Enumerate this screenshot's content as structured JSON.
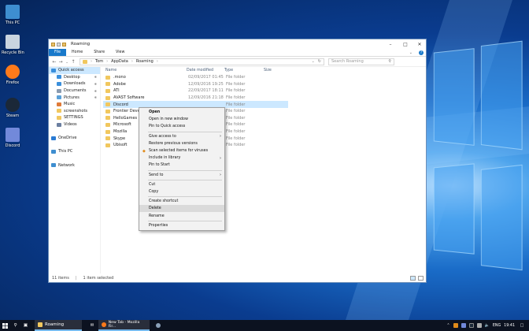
{
  "desktop": {
    "icons": [
      {
        "label": "This PC",
        "icon": "this-pc-icon",
        "color": "#3e8ed0"
      },
      {
        "label": "Recycle Bin",
        "icon": "recycle-bin-icon",
        "color": "#c9d4df"
      },
      {
        "label": "Firefox",
        "icon": "firefox-icon",
        "color": "#ff7a1a"
      },
      {
        "label": "Steam",
        "icon": "steam-icon",
        "color": "#1b2838"
      },
      {
        "label": "Discord",
        "icon": "discord-icon",
        "color": "#7289da"
      }
    ]
  },
  "explorer": {
    "title": "Roaming",
    "ribbon_tabs": [
      "File",
      "Home",
      "Share",
      "View"
    ],
    "breadcrumb": [
      "Tom",
      "AppData",
      "Roaming"
    ],
    "search_placeholder": "Search Roaming",
    "nav": [
      {
        "label": "Quick access",
        "icon": "star-icon",
        "color": "#3a8fdc",
        "pinned": false,
        "selected": true
      },
      {
        "label": "Desktop",
        "icon": "folder-icon",
        "color": "#3a8fdc",
        "pinned": true
      },
      {
        "label": "Downloads",
        "icon": "download-icon",
        "color": "#3a8fdc",
        "pinned": true
      },
      {
        "label": "Documents",
        "icon": "documents-icon",
        "color": "#8a9bb0",
        "pinned": true
      },
      {
        "label": "Pictures",
        "icon": "pictures-icon",
        "color": "#5aa0d8",
        "pinned": true
      },
      {
        "label": "Music",
        "icon": "music-icon",
        "color": "#e07b39"
      },
      {
        "label": "screenshots",
        "icon": "folder-icon",
        "color": "#f1c75e"
      },
      {
        "label": "SETTINGS",
        "icon": "folder-icon",
        "color": "#f1c75e"
      },
      {
        "label": "Videos",
        "icon": "videos-icon",
        "color": "#6b7fa0"
      },
      {
        "label": "",
        "icon": "",
        "color": ""
      },
      {
        "label": "OneDrive",
        "icon": "onedrive-icon",
        "color": "#2a7bd4"
      },
      {
        "label": "",
        "icon": "",
        "color": ""
      },
      {
        "label": "This PC",
        "icon": "this-pc-icon",
        "color": "#3e8ed0"
      },
      {
        "label": "",
        "icon": "",
        "color": ""
      },
      {
        "label": "Network",
        "icon": "network-icon",
        "color": "#3e8ed0"
      }
    ],
    "columns": {
      "name": "Name",
      "date": "Date modified",
      "type": "Type",
      "size": "Size"
    },
    "files": [
      {
        "name": ".mono",
        "date": "02/09/2017 01:45",
        "type": "File folder"
      },
      {
        "name": "Adobe",
        "date": "12/09/2016 19:25",
        "type": "File folder"
      },
      {
        "name": "ATI",
        "date": "22/09/2017 18:11",
        "type": "File folder"
      },
      {
        "name": "AVAST Software",
        "date": "12/09/2016 21:18",
        "type": "File folder"
      },
      {
        "name": "Discord",
        "date": "",
        "type": "File folder",
        "selected": true
      },
      {
        "name": "Frontier Develo",
        "date": "",
        "type": "File folder"
      },
      {
        "name": "HelloGames",
        "date": "",
        "type": "File folder"
      },
      {
        "name": "Microsoft",
        "date": "",
        "type": "File folder"
      },
      {
        "name": "Mozilla",
        "date": "",
        "type": "File folder"
      },
      {
        "name": "Skype",
        "date": "",
        "type": "File folder"
      },
      {
        "name": "Ubisoft",
        "date": "",
        "type": "File folder"
      }
    ],
    "status": {
      "count": "11 items",
      "selected": "1 item selected"
    }
  },
  "context_menu": [
    {
      "label": "Open",
      "bold": true
    },
    {
      "label": "Open in new window"
    },
    {
      "label": "Pin to Quick access"
    },
    {
      "sep": true
    },
    {
      "label": "Give access to",
      "arrow": true
    },
    {
      "label": "Restore previous versions"
    },
    {
      "label": "Scan selected items for viruses",
      "icon": "avast-icon"
    },
    {
      "label": "Include in library",
      "arrow": true
    },
    {
      "label": "Pin to Start"
    },
    {
      "sep": true
    },
    {
      "label": "Send to",
      "arrow": true
    },
    {
      "sep": true
    },
    {
      "label": "Cut"
    },
    {
      "label": "Copy"
    },
    {
      "sep": true
    },
    {
      "label": "Create shortcut"
    },
    {
      "label": "Delete",
      "hover": true
    },
    {
      "label": "Rename"
    },
    {
      "sep": true
    },
    {
      "label": "Properties"
    }
  ],
  "taskbar": {
    "apps": [
      {
        "label": "Roaming",
        "icon": "folder-icon",
        "color": "#f1c75e"
      },
      {
        "label": "New Tab - Mozilla Fir...",
        "icon": "firefox-icon",
        "color": "#ff7a1a"
      }
    ],
    "lang": "ENG",
    "time": "19:41"
  }
}
